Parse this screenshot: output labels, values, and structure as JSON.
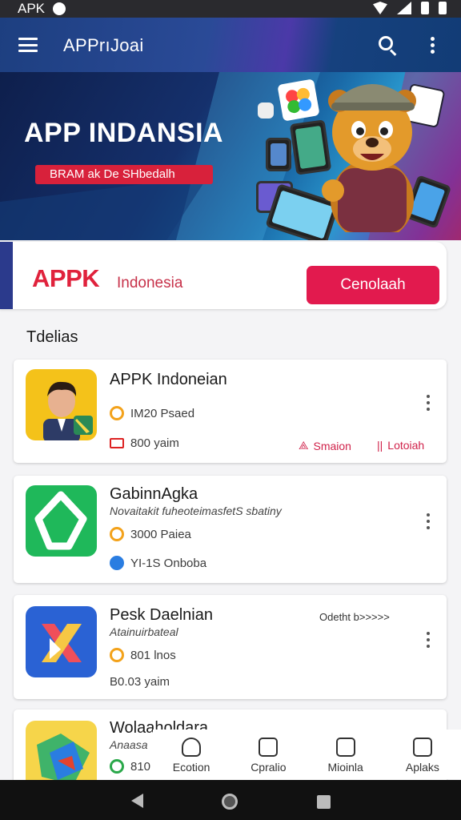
{
  "status_bar": {
    "left_text": "APK"
  },
  "app_bar": {
    "title": "APPrıJoai"
  },
  "banner": {
    "title": "APP INDANSIA",
    "subtitle": "BRAM ak De SHbedalh"
  },
  "brand_strip": {
    "logo": "APPK",
    "name": "Indonesia",
    "button_label": "Cenolaah"
  },
  "section_title": "Tdelias",
  "apps": [
    {
      "name": "APPK Indoneian",
      "meta1": "IM20 Psaed",
      "meta2": "800 yaim",
      "link1": "Smaion",
      "link2": "Lotoiah"
    },
    {
      "name": "GabinnAgka",
      "desc": "Novaitakit fuheoteimasfetS sbatiny",
      "meta1": "3000 Paiea",
      "meta2": "YI-1S Onboba"
    },
    {
      "name": "Pesk Daelnian",
      "tag": "Odetht b>>>>>",
      "desc": "Atainuirbateal",
      "meta1": "801 lnos",
      "meta2": "B0.03 yaim"
    },
    {
      "name": "Wolaaholdara",
      "desc": "Anaasa",
      "meta1": "810"
    }
  ],
  "bottom_nav": [
    {
      "label": "Ecotion"
    },
    {
      "label": "Cpralio"
    },
    {
      "label": "Mioinla"
    },
    {
      "label": "Aplaks"
    }
  ]
}
